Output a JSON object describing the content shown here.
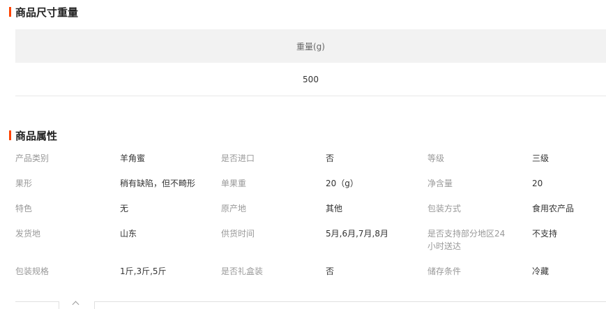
{
  "size_section": {
    "title": "商品尺寸重量",
    "header": "重量(g)",
    "value": "500"
  },
  "attrs_section": {
    "title": "商品属性",
    "rows": [
      [
        {
          "label": "产品类别",
          "value": "羊角蜜"
        },
        {
          "label": "是否进口",
          "value": "否"
        },
        {
          "label": "等级",
          "value": "三级"
        }
      ],
      [
        {
          "label": "果形",
          "value": "稍有缺陷，但不畸形"
        },
        {
          "label": "单果重",
          "value": "20（g）"
        },
        {
          "label": "净含量",
          "value": "20"
        }
      ],
      [
        {
          "label": "特色",
          "value": "无"
        },
        {
          "label": "原产地",
          "value": "其他"
        },
        {
          "label": "包装方式",
          "value": "食用农产品"
        }
      ],
      [
        {
          "label": "发货地",
          "value": "山东"
        },
        {
          "label": "供货时间",
          "value": "5月,6月,7月,8月"
        },
        {
          "label": "是否支持部分地区24小时送达",
          "value": "不支持"
        }
      ],
      [
        {
          "label": "包装规格",
          "value": "1斤,3斤,5斤"
        },
        {
          "label": "是否礼盒装",
          "value": "否"
        },
        {
          "label": "储存条件",
          "value": "冷藏"
        }
      ]
    ]
  },
  "colors": {
    "accent": "#ff4400",
    "header_bg": "#f2f2f2",
    "label": "#999999",
    "value": "#333333"
  },
  "icons": {
    "collapse": "chevron-up-icon"
  }
}
